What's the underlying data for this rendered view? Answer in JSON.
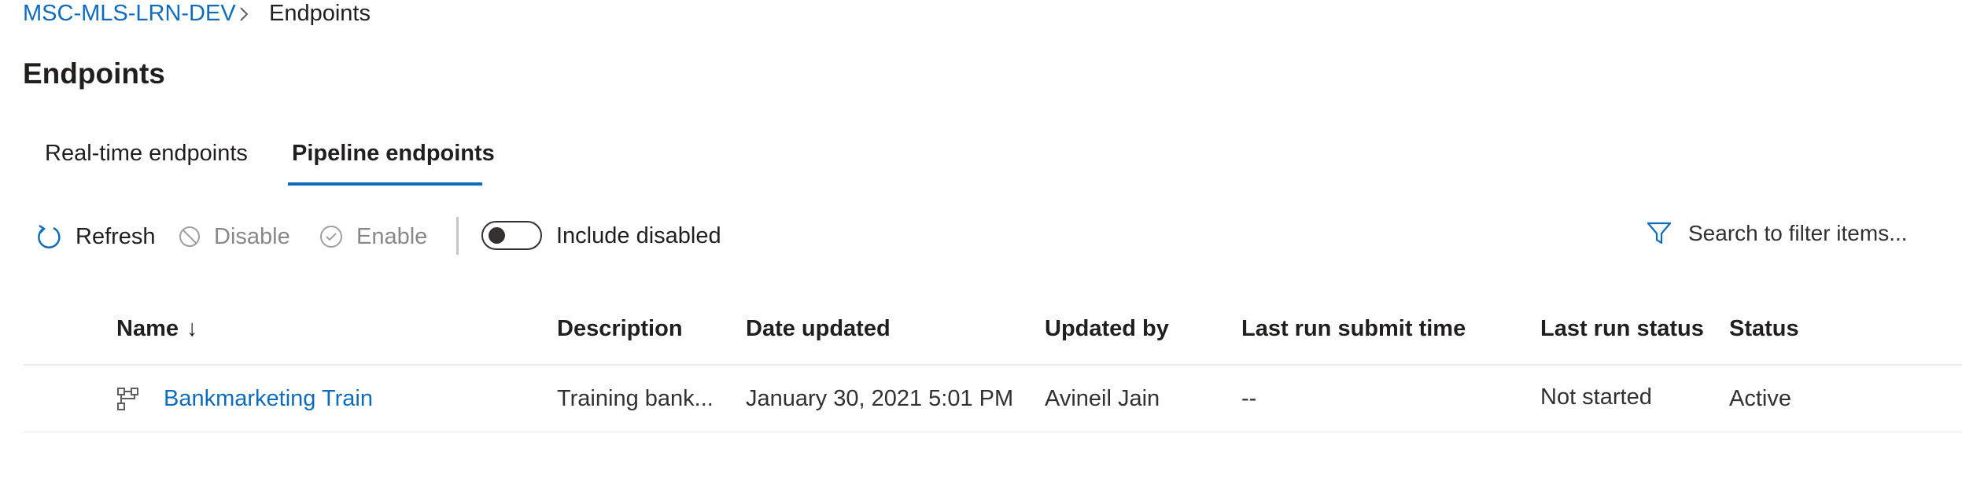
{
  "breadcrumb": {
    "workspace": "MSC-MLS-LRN-DEV",
    "current": "Endpoints"
  },
  "page": {
    "title": "Endpoints"
  },
  "tabs": [
    {
      "label": "Real-time endpoints",
      "selected": false
    },
    {
      "label": "Pipeline endpoints",
      "selected": true
    }
  ],
  "toolbar": {
    "refresh_label": "Refresh",
    "disable_label": "Disable",
    "enable_label": "Enable",
    "include_disabled_label": "Include disabled",
    "include_disabled_on": false,
    "search_placeholder": "Search to filter items..."
  },
  "table": {
    "columns": [
      "Name",
      "Description",
      "Date updated",
      "Updated by",
      "Last run submit time",
      "Last run status",
      "Status"
    ],
    "sort_indicator": "↓",
    "rows": [
      {
        "name": "Bankmarketing Train",
        "description": "Training bank...",
        "date_updated": "January 30, 2021 5:01 PM",
        "updated_by": "Avineil Jain",
        "last_run_submit_time": "--",
        "last_run_status": "Not started",
        "status": "Active"
      }
    ]
  },
  "colors": {
    "accent": "#0f6cbd",
    "text": "#201f1e",
    "disabled": "#8a8886"
  }
}
